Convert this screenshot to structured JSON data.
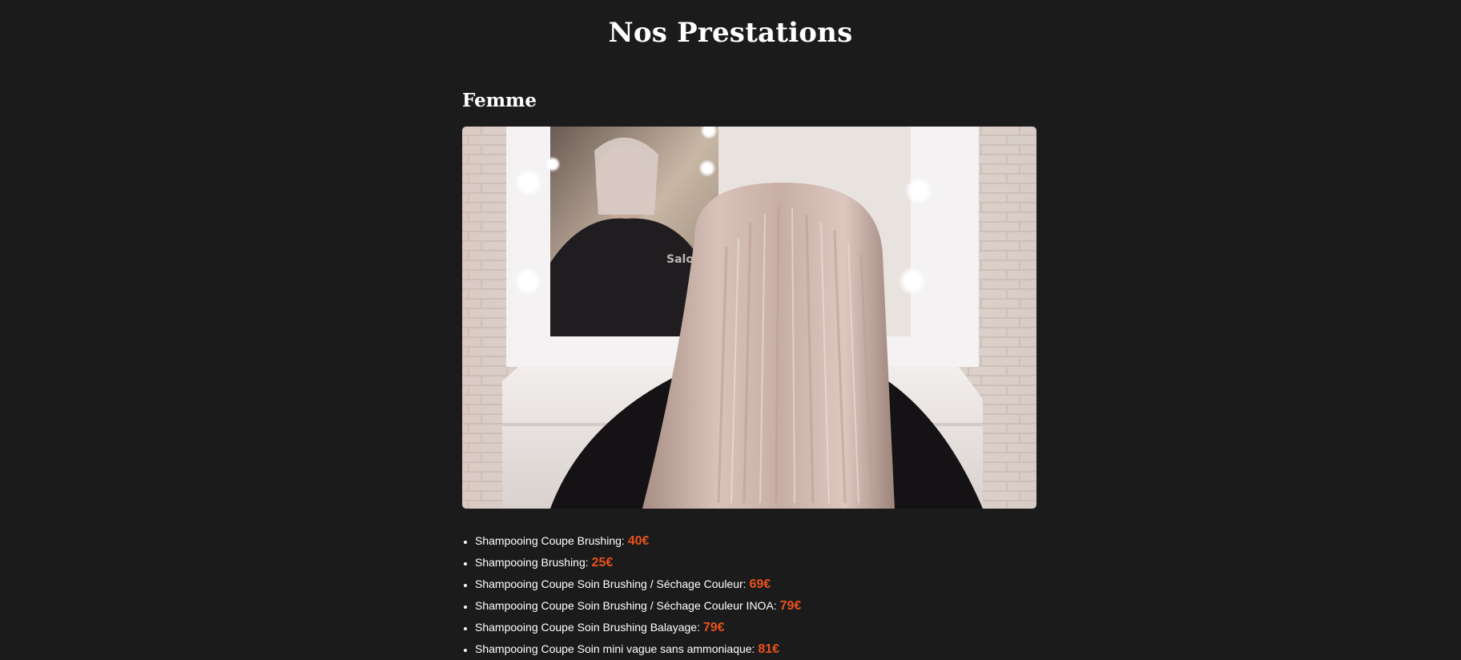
{
  "page": {
    "title": "Nos Prestations"
  },
  "section": {
    "title": "Femme",
    "image": {
      "alt": "blonde-hair-salon-mirror-photo"
    }
  },
  "services": [
    {
      "label": "Shampooing Coupe Brushing:",
      "price": "40€"
    },
    {
      "label": "Shampooing Brushing:",
      "price": "25€"
    },
    {
      "label": "Shampooing Coupe Soin Brushing / Séchage Couleur:",
      "price": "69€"
    },
    {
      "label": "Shampooing Coupe Soin Brushing / Séchage Couleur INOA:",
      "price": "79€"
    },
    {
      "label": "Shampooing Coupe Soin Brushing Balayage:",
      "price": "79€"
    },
    {
      "label": "Shampooing Coupe Soin mini vague sans ammoniaque:",
      "price": "81€"
    }
  ],
  "colors": {
    "background": "#1b1b1b",
    "text": "#ffffff",
    "price_accent": "#e8511e"
  }
}
